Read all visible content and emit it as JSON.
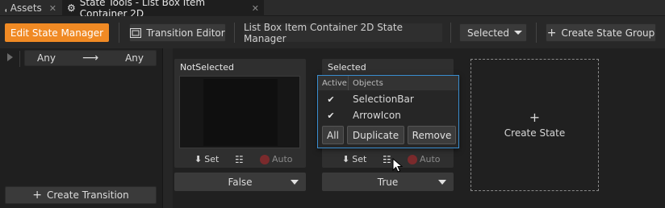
{
  "tabs": [
    {
      "label": "Assets",
      "icon": "assets-icon"
    },
    {
      "label": "State Tools - List Box Item Container 2D",
      "icon": "gear-icon"
    }
  ],
  "toolbar": {
    "edit_state_manager": "Edit State Manager",
    "transition_editor": "Transition Editor",
    "state_manager_name": "List Box Item Container 2D State Manager",
    "selected_state": "Selected",
    "create_state_group": "Create State Group"
  },
  "transition": {
    "from": "Any",
    "to": "Any",
    "create_transition": "Create Transition"
  },
  "states": [
    {
      "name": "NotSelected",
      "set_label": "Set",
      "auto_label": "Auto",
      "value": "False"
    },
    {
      "name": "Selected",
      "set_label": "Set",
      "auto_label": "Auto",
      "value": "True"
    }
  ],
  "popup": {
    "col_active": "Active",
    "col_objects": "Objects",
    "rows": [
      {
        "checked": "✔",
        "object": "SelectionBar"
      },
      {
        "checked": "✔",
        "object": "ArrowIcon"
      }
    ],
    "all_label": "All",
    "duplicate_label": "Duplicate",
    "remove_label": "Remove"
  },
  "create_state": {
    "plus": "+",
    "label": "Create State"
  },
  "colors": {
    "accent_orange": "#f08a24",
    "focus_blue": "#3a8ed0",
    "auto_red": "#c9353a"
  }
}
